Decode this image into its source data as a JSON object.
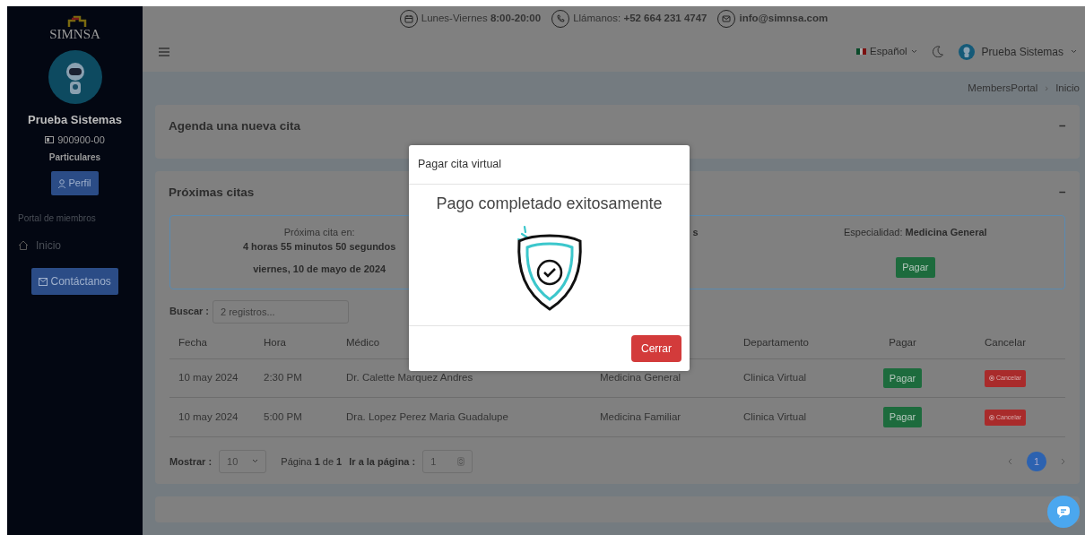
{
  "sidebar": {
    "logo": "SIMNSA",
    "user_name": "Prueba Sistemas",
    "member_id": "900900-00",
    "plan": "Particulares",
    "profile_button": "Perfil",
    "section_title": "Portal de miembros",
    "items": [
      {
        "label": "Inicio",
        "selected": false
      }
    ],
    "contact_button": "Contáctanos"
  },
  "top_info": [
    {
      "kind": "calendar",
      "label": "Lunes-Viernes ",
      "value": "8:00-20:00"
    },
    {
      "kind": "phone",
      "label": "Llámanos: ",
      "value": "+52 664 231 4747"
    },
    {
      "kind": "mail",
      "value": "info@simnsa.com"
    }
  ],
  "navbar": {
    "language": "Español",
    "user_name": "Prueba Sistemas"
  },
  "breadcrumb": [
    "MembersPortal",
    "Inicio"
  ],
  "breadcrumb_separator": "›",
  "new_appointment_card": {
    "title": "Agenda una nueva cita",
    "collapse": "−"
  },
  "upcoming_card": {
    "title": "Próximas citas",
    "collapse": "−",
    "next": {
      "label": "Próxima cita en:",
      "countdown": "4 horas 55 minutos 50 segundos",
      "date": "viernes, 10 de mayo de 2024"
    },
    "column_2": "s",
    "specialty": "Especialidad: **Medicina General**",
    "pay_button": "Pagar",
    "search_label": "Buscar :",
    "search_placeholder": "2 registros...",
    "columns": [
      {
        "label": "Fecha"
      },
      {
        "label": "Hora"
      },
      {
        "label": "Médico"
      },
      {},
      {
        "label": "Departamento"
      },
      {
        "label": "Pagar"
      },
      {
        "label": "Cancelar"
      }
    ],
    "rows": [
      {
        "date": "10 may 2024",
        "time": "2:30 PM",
        "doctor": "Dr. Calette Marquez Andres",
        "specialty": "Medicina General",
        "department": "Clinica Virtual",
        "pay": "Pagar",
        "cancel": "Cancelar"
      },
      {
        "date": "10 may 2024",
        "time": "5:00 PM",
        "doctor": "Dra. Lopez Perez Maria Guadalupe",
        "specialty": "Medicina Familiar",
        "department": "Clinica Virtual",
        "pay": "Pagar",
        "cancel": "Cancelar"
      }
    ],
    "show_label": "Mostrar :",
    "page_size": "10",
    "page_info": "Página **1** de **1**",
    "goto_label": "Ir a la página :",
    "goto_value": "1",
    "pages": [
      {
        "label": "1",
        "selected": true
      }
    ]
  },
  "modal": {
    "title": "Pagar cita virtual",
    "message": "Pago completado exitosamente",
    "close_button": "Cerrar"
  }
}
